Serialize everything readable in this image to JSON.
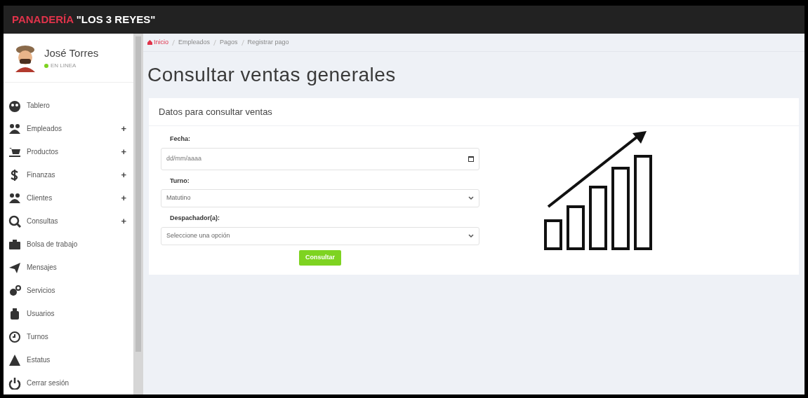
{
  "header": {
    "brand_accent": "PANADERÍA",
    "brand_rest": "\"LOS 3 REYES\""
  },
  "user": {
    "name": "José Torres",
    "status": "EN LINEA",
    "online": true
  },
  "sidebar": {
    "items": [
      {
        "label": "Tablero"
      },
      {
        "label": "Empleados",
        "toggle": "+"
      },
      {
        "label": "Productos",
        "toggle": "+"
      },
      {
        "label": "Finanzas",
        "toggle": "+"
      },
      {
        "label": "Clientes",
        "toggle": "+"
      },
      {
        "label": "Consultas",
        "toggle": "+"
      },
      {
        "label": "Bolsa de trabajo"
      },
      {
        "label": "Mensajes"
      },
      {
        "label": "Servicios"
      },
      {
        "label": "Usuarios"
      },
      {
        "label": "Turnos"
      },
      {
        "label": "Estatus"
      },
      {
        "label": "Cerrar sesión"
      }
    ]
  },
  "breadcrumb": [
    {
      "label": "Inicio",
      "kind": "home"
    },
    {
      "label": "Empleados",
      "kind": "link"
    },
    {
      "label": "Pagos",
      "kind": "link"
    },
    {
      "label": "Registrar pago",
      "kind": "link"
    }
  ],
  "page_title": "Consultar ventas generales",
  "card": {
    "title": "Datos para consultar ventas",
    "fields": [
      {
        "label": "Fecha:",
        "kind": "date",
        "placeholder": "dd/mm/aaaa"
      },
      {
        "label": "Turno:",
        "kind": "select",
        "value": "Matutino"
      },
      {
        "label": "Despachador(a):",
        "kind": "select",
        "value": "Seleccione una opción"
      }
    ],
    "button": "Consultar"
  }
}
